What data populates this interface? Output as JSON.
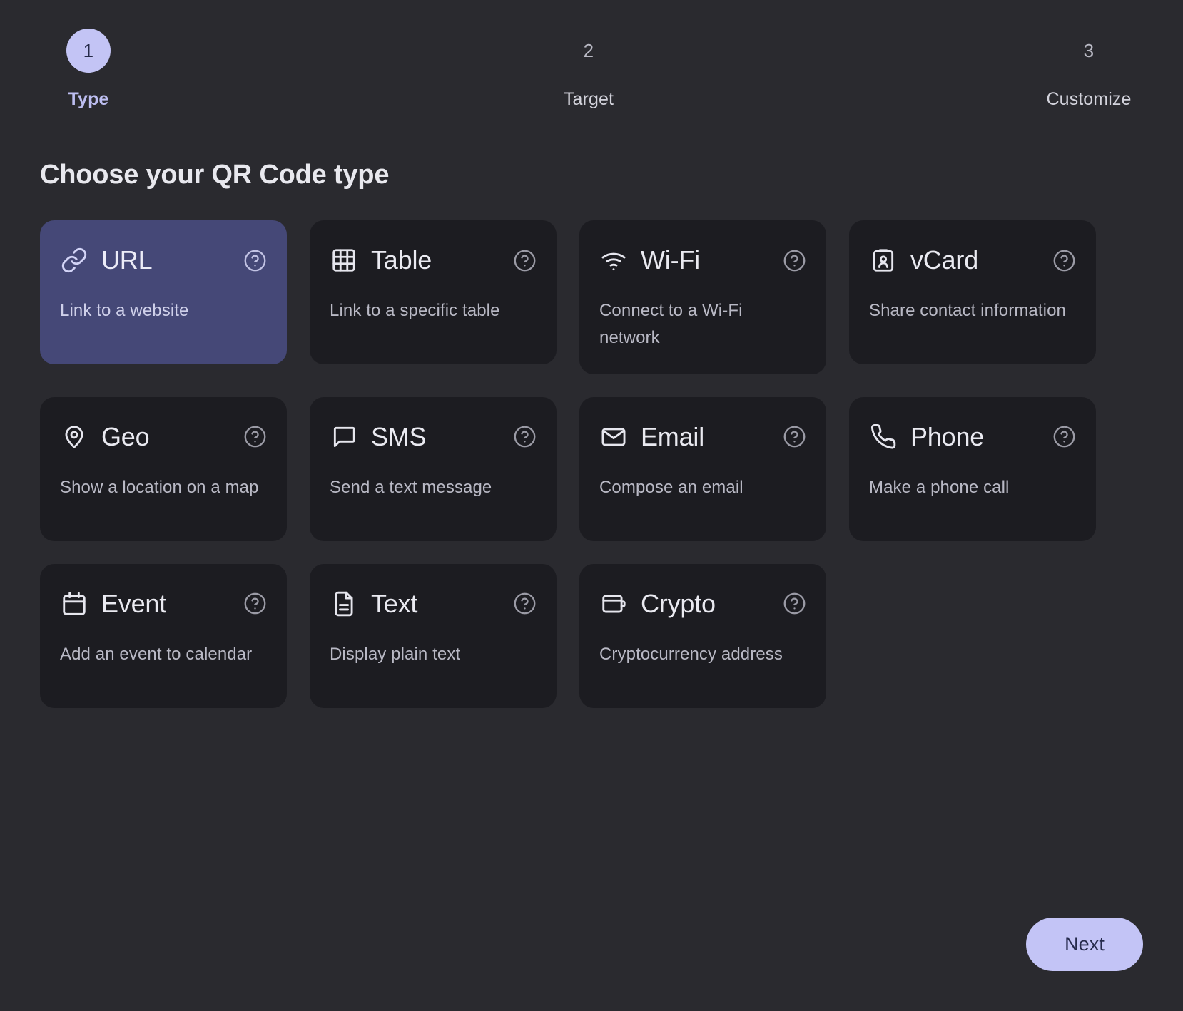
{
  "stepper": {
    "steps": [
      {
        "number": "1",
        "label": "Type",
        "active": true
      },
      {
        "number": "2",
        "label": "Target",
        "active": false
      },
      {
        "number": "3",
        "label": "Customize",
        "active": false
      }
    ]
  },
  "heading": "Choose your QR Code type",
  "types": [
    {
      "id": "url",
      "title": "URL",
      "desc": "Link to a website",
      "icon": "link-icon",
      "selected": true,
      "help": "?"
    },
    {
      "id": "table",
      "title": "Table",
      "desc": "Link to a specific table",
      "icon": "table-icon",
      "selected": false,
      "help": "?"
    },
    {
      "id": "wifi",
      "title": "Wi-Fi",
      "desc": "Connect to a Wi-Fi network",
      "icon": "wifi-icon",
      "selected": false,
      "help": "?"
    },
    {
      "id": "vcard",
      "title": "vCard",
      "desc": "Share contact information",
      "icon": "id-badge-icon",
      "selected": false,
      "help": "?"
    },
    {
      "id": "geo",
      "title": "Geo",
      "desc": "Show a location on a map",
      "icon": "map-pin-icon",
      "selected": false,
      "help": "?"
    },
    {
      "id": "sms",
      "title": "SMS",
      "desc": "Send a text message",
      "icon": "chat-bubble-icon",
      "selected": false,
      "help": "?"
    },
    {
      "id": "email",
      "title": "Email",
      "desc": "Compose an email",
      "icon": "envelope-icon",
      "selected": false,
      "help": "?"
    },
    {
      "id": "phone",
      "title": "Phone",
      "desc": "Make a phone call",
      "icon": "phone-icon",
      "selected": false,
      "help": "?"
    },
    {
      "id": "event",
      "title": "Event",
      "desc": "Add an event to calendar",
      "icon": "calendar-icon",
      "selected": false,
      "help": "?"
    },
    {
      "id": "text",
      "title": "Text",
      "desc": "Display plain text",
      "icon": "document-icon",
      "selected": false,
      "help": "?"
    },
    {
      "id": "crypto",
      "title": "Crypto",
      "desc": "Cryptocurrency address",
      "icon": "wallet-icon",
      "selected": false,
      "help": "?"
    }
  ],
  "footer": {
    "next_label": "Next"
  },
  "colors": {
    "page_background": "#2a2a2f",
    "card_background": "#1c1c21",
    "card_selected_background": "#454877",
    "accent": "#c3c4f6",
    "accent_text": "#262b4c",
    "title_text": "#e8e8ee",
    "muted_text": "#b9b9c5"
  }
}
